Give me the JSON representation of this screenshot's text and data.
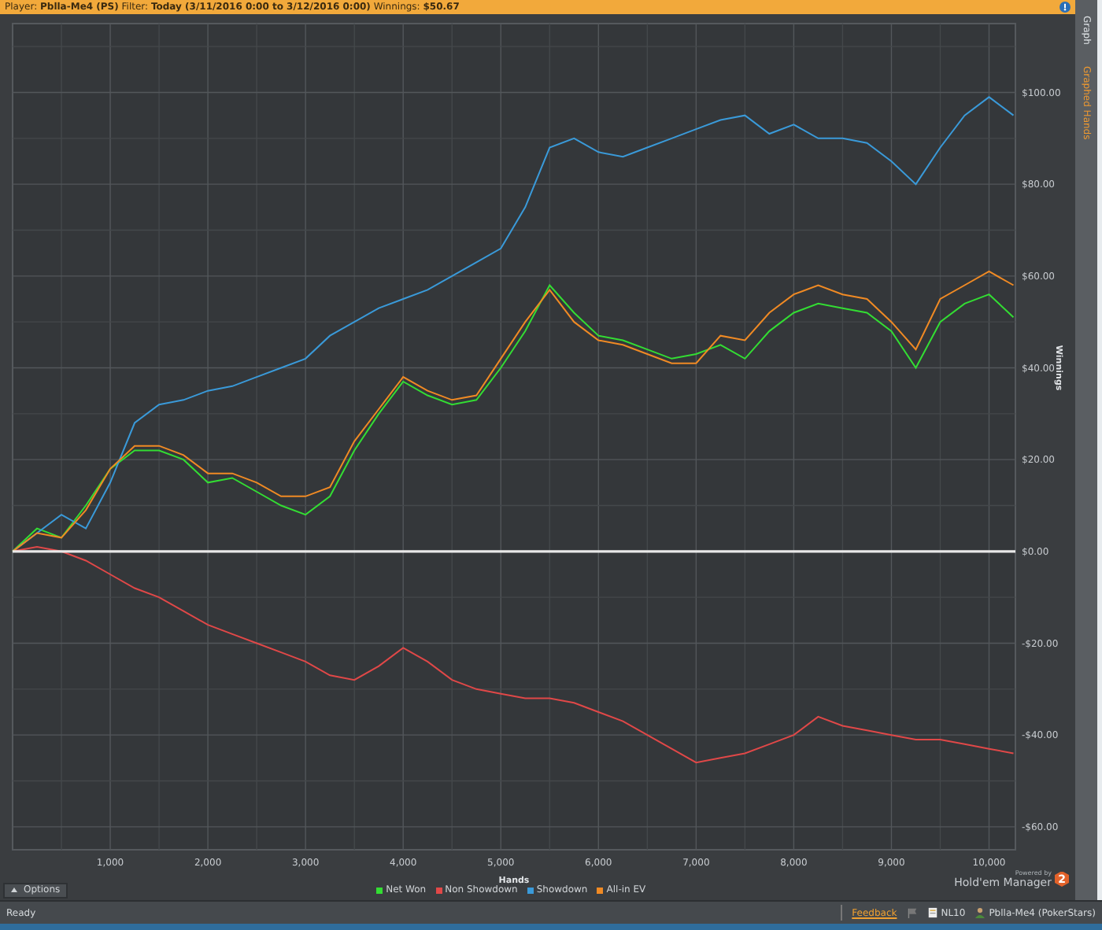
{
  "header": {
    "text": "Player: **Pblla-Me4 (PS)** Filter: **Today (3/11/2016 0:00 to 3/12/2016 0:00)** Winnings: **$50.67**"
  },
  "side_tabs": [
    {
      "label": "Graph",
      "selected": false
    },
    {
      "label": "Graphed Hands",
      "selected": true
    }
  ],
  "chart": {
    "chart_data": {
      "type": "line",
      "grid": true,
      "xlabel": "Hands",
      "ylabel": "Winnings",
      "xlim": [
        0,
        10270
      ],
      "ylim": [
        -65,
        115
      ],
      "x": [
        0,
        250,
        500,
        750,
        1000,
        1250,
        1500,
        1750,
        2000,
        2250,
        2500,
        2750,
        3000,
        3250,
        3500,
        3750,
        4000,
        4250,
        4500,
        4750,
        5000,
        5250,
        5500,
        5750,
        6000,
        6250,
        6500,
        6750,
        7000,
        7250,
        7500,
        7750,
        8000,
        8250,
        8500,
        8750,
        9000,
        9250,
        9500,
        9750,
        10000,
        10250
      ],
      "xticks": [
        {
          "value": 1000,
          "label": "1,000"
        },
        {
          "value": 2000,
          "label": "2,000"
        },
        {
          "value": 3000,
          "label": "3,000"
        },
        {
          "value": 4000,
          "label": "4,000"
        },
        {
          "value": 5000,
          "label": "5,000"
        },
        {
          "value": 6000,
          "label": "6,000"
        },
        {
          "value": 7000,
          "label": "7,000"
        },
        {
          "value": 8000,
          "label": "8,000"
        },
        {
          "value": 9000,
          "label": "9,000"
        },
        {
          "value": 10000,
          "label": "10,000"
        }
      ],
      "yticks": [
        {
          "value": 100,
          "label": "$100.00"
        },
        {
          "value": 80,
          "label": "$80.00"
        },
        {
          "value": 60,
          "label": "$60.00"
        },
        {
          "value": 40,
          "label": "$40.00"
        },
        {
          "value": 20,
          "label": "$20.00"
        },
        {
          "value": 0,
          "label": "$0.00"
        },
        {
          "value": -20,
          "label": "-$20.00"
        },
        {
          "value": -40,
          "label": "-$40.00"
        },
        {
          "value": -60,
          "label": "-$60.00"
        }
      ],
      "series": [
        {
          "name": "Net Won",
          "color": "#33dd33",
          "values": [
            0,
            5,
            3,
            10,
            18,
            22,
            22,
            20,
            15,
            16,
            13,
            10,
            8,
            12,
            22,
            30,
            37,
            34,
            32,
            33,
            40,
            48,
            58,
            52,
            47,
            46,
            44,
            42,
            43,
            45,
            42,
            48,
            52,
            54,
            53,
            52,
            48,
            40,
            50,
            54,
            56,
            51
          ]
        },
        {
          "name": "Non Showdown",
          "color": "#e04848",
          "values": [
            0,
            1,
            0,
            -2,
            -5,
            -8,
            -10,
            -13,
            -16,
            -18,
            -20,
            -22,
            -24,
            -27,
            -28,
            -25,
            -21,
            -24,
            -28,
            -30,
            -31,
            -32,
            -32,
            -33,
            -35,
            -37,
            -40,
            -43,
            -46,
            -45,
            -44,
            -42,
            -40,
            -36,
            -38,
            -39,
            -40,
            -41,
            -41,
            -42,
            -43,
            -44
          ]
        },
        {
          "name": "Showdown",
          "color": "#3a9ad9",
          "values": [
            0,
            4,
            8,
            5,
            15,
            28,
            32,
            33,
            35,
            36,
            38,
            40,
            42,
            47,
            50,
            53,
            55,
            57,
            60,
            63,
            66,
            75,
            88,
            90,
            87,
            86,
            88,
            90,
            92,
            94,
            95,
            91,
            93,
            90,
            90,
            89,
            85,
            80,
            88,
            95,
            99,
            95
          ]
        },
        {
          "name": "All-in EV",
          "color": "#f08a24",
          "values": [
            0,
            4,
            3,
            9,
            18,
            23,
            23,
            21,
            17,
            17,
            15,
            12,
            12,
            14,
            24,
            31,
            38,
            35,
            33,
            34,
            42,
            50,
            57,
            50,
            46,
            45,
            43,
            41,
            41,
            47,
            46,
            52,
            56,
            58,
            56,
            55,
            50,
            44,
            55,
            58,
            61,
            58
          ]
        }
      ]
    }
  },
  "options_button": {
    "label": "Options"
  },
  "branding": {
    "powered_by": "Powered by",
    "product": "Hold'em Manager",
    "badge": "2"
  },
  "status_bar": {
    "status": "Ready",
    "feedback": "Feedback",
    "stakes": "NL10",
    "player": "Pblla-Me4 (PokerStars)"
  }
}
